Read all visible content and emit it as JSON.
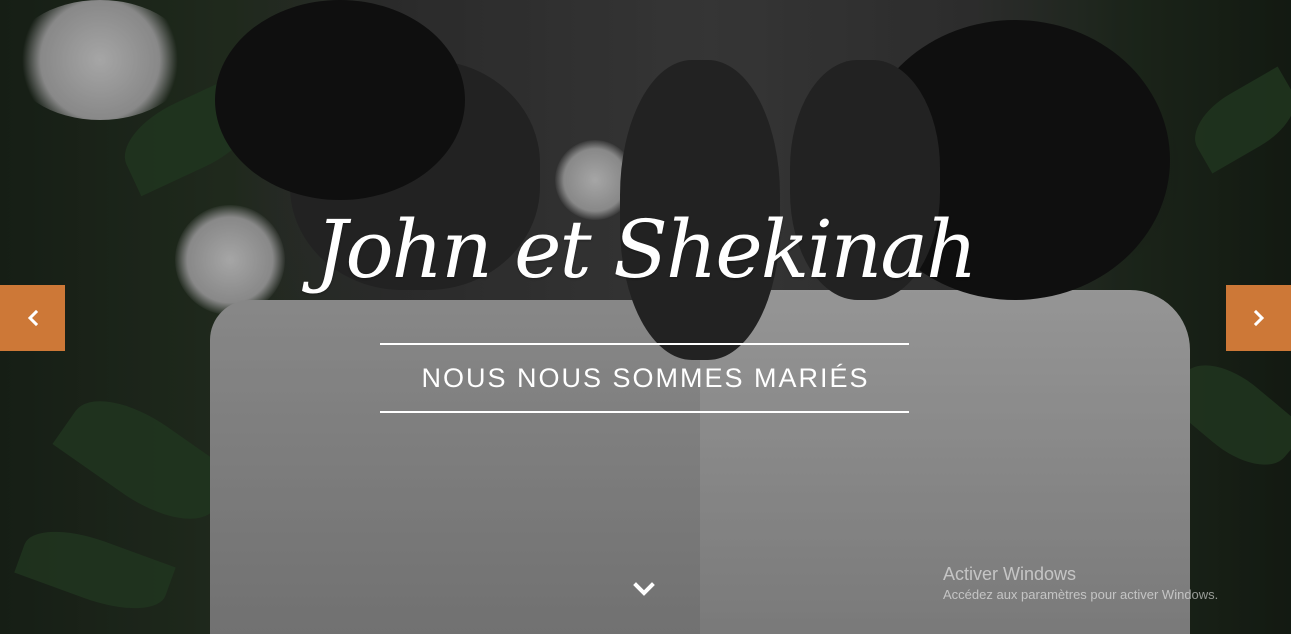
{
  "hero": {
    "title": "John et Shekinah",
    "subtitle": "NOUS NOUS SOMMES MARIÉS"
  },
  "carousel": {
    "prev_icon": "chevron-left-icon",
    "next_icon": "chevron-right-icon",
    "arrow_color": "#cd7837",
    "scroll_icon": "chevron-down-icon"
  },
  "watermark": {
    "title": "Activer Windows",
    "subtitle": "Accédez aux paramètres pour activer Windows."
  }
}
